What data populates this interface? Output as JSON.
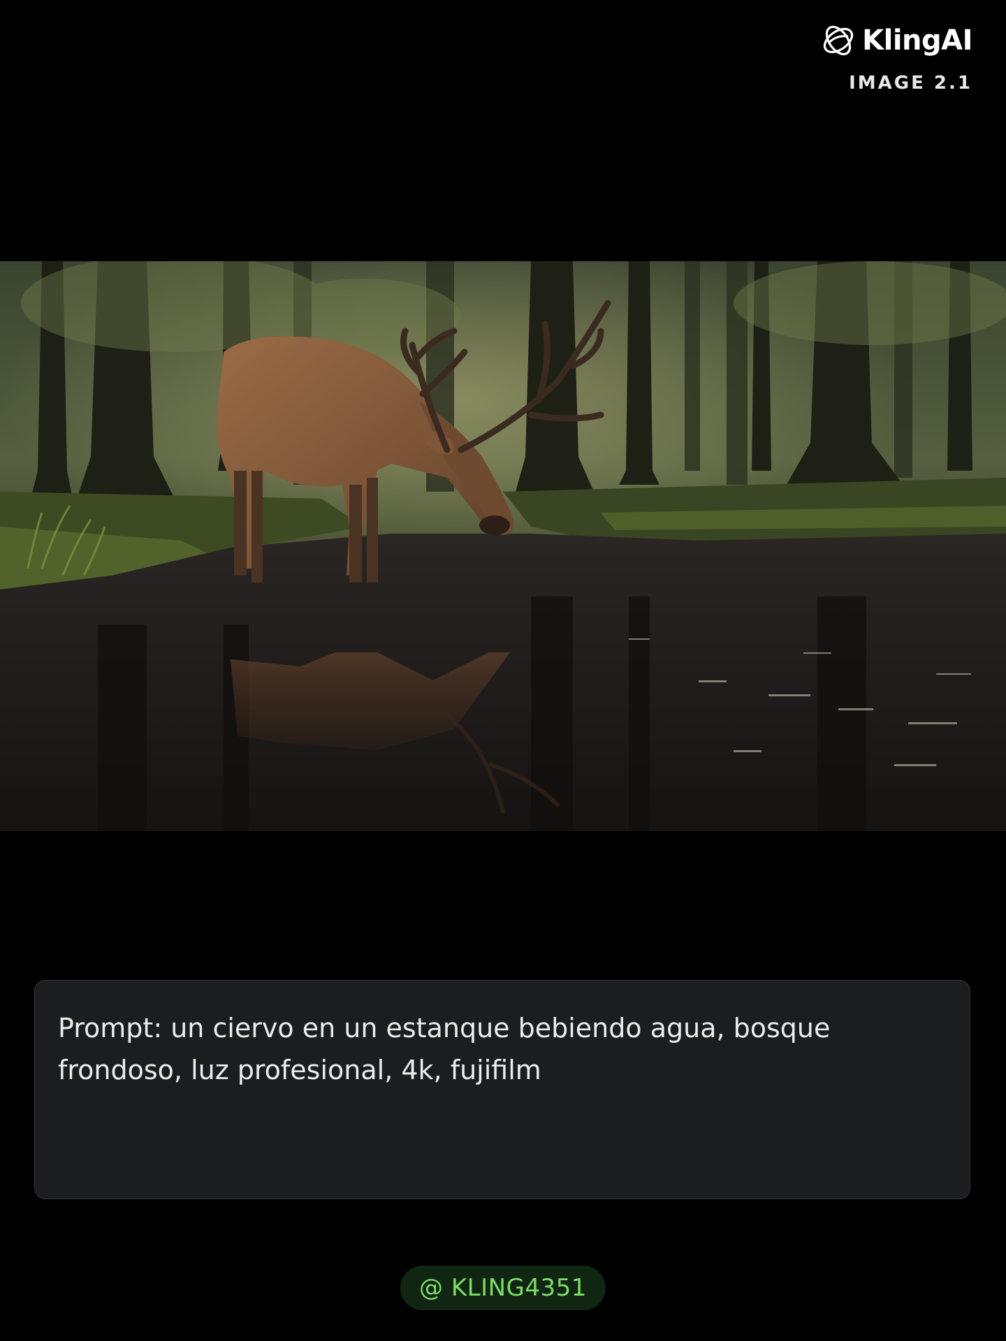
{
  "brand": {
    "name": "KlingAI",
    "version": "IMAGE 2.1",
    "logo_icon": "kling-logo-icon"
  },
  "hero_image": {
    "subject": "deer-drinking-in-forest-pond"
  },
  "prompt": {
    "text": "Prompt: un ciervo en un estanque bebiendo agua, bosque frondoso, luz profesional, 4k, fujifilm"
  },
  "handle": {
    "text": "@ KLING4351"
  },
  "colors": {
    "background": "#000000",
    "card_background": "#1c1d1f",
    "card_border": "#34363a",
    "handle_background": "#112513",
    "handle_text": "#7dde66",
    "text_primary": "#ececec"
  }
}
